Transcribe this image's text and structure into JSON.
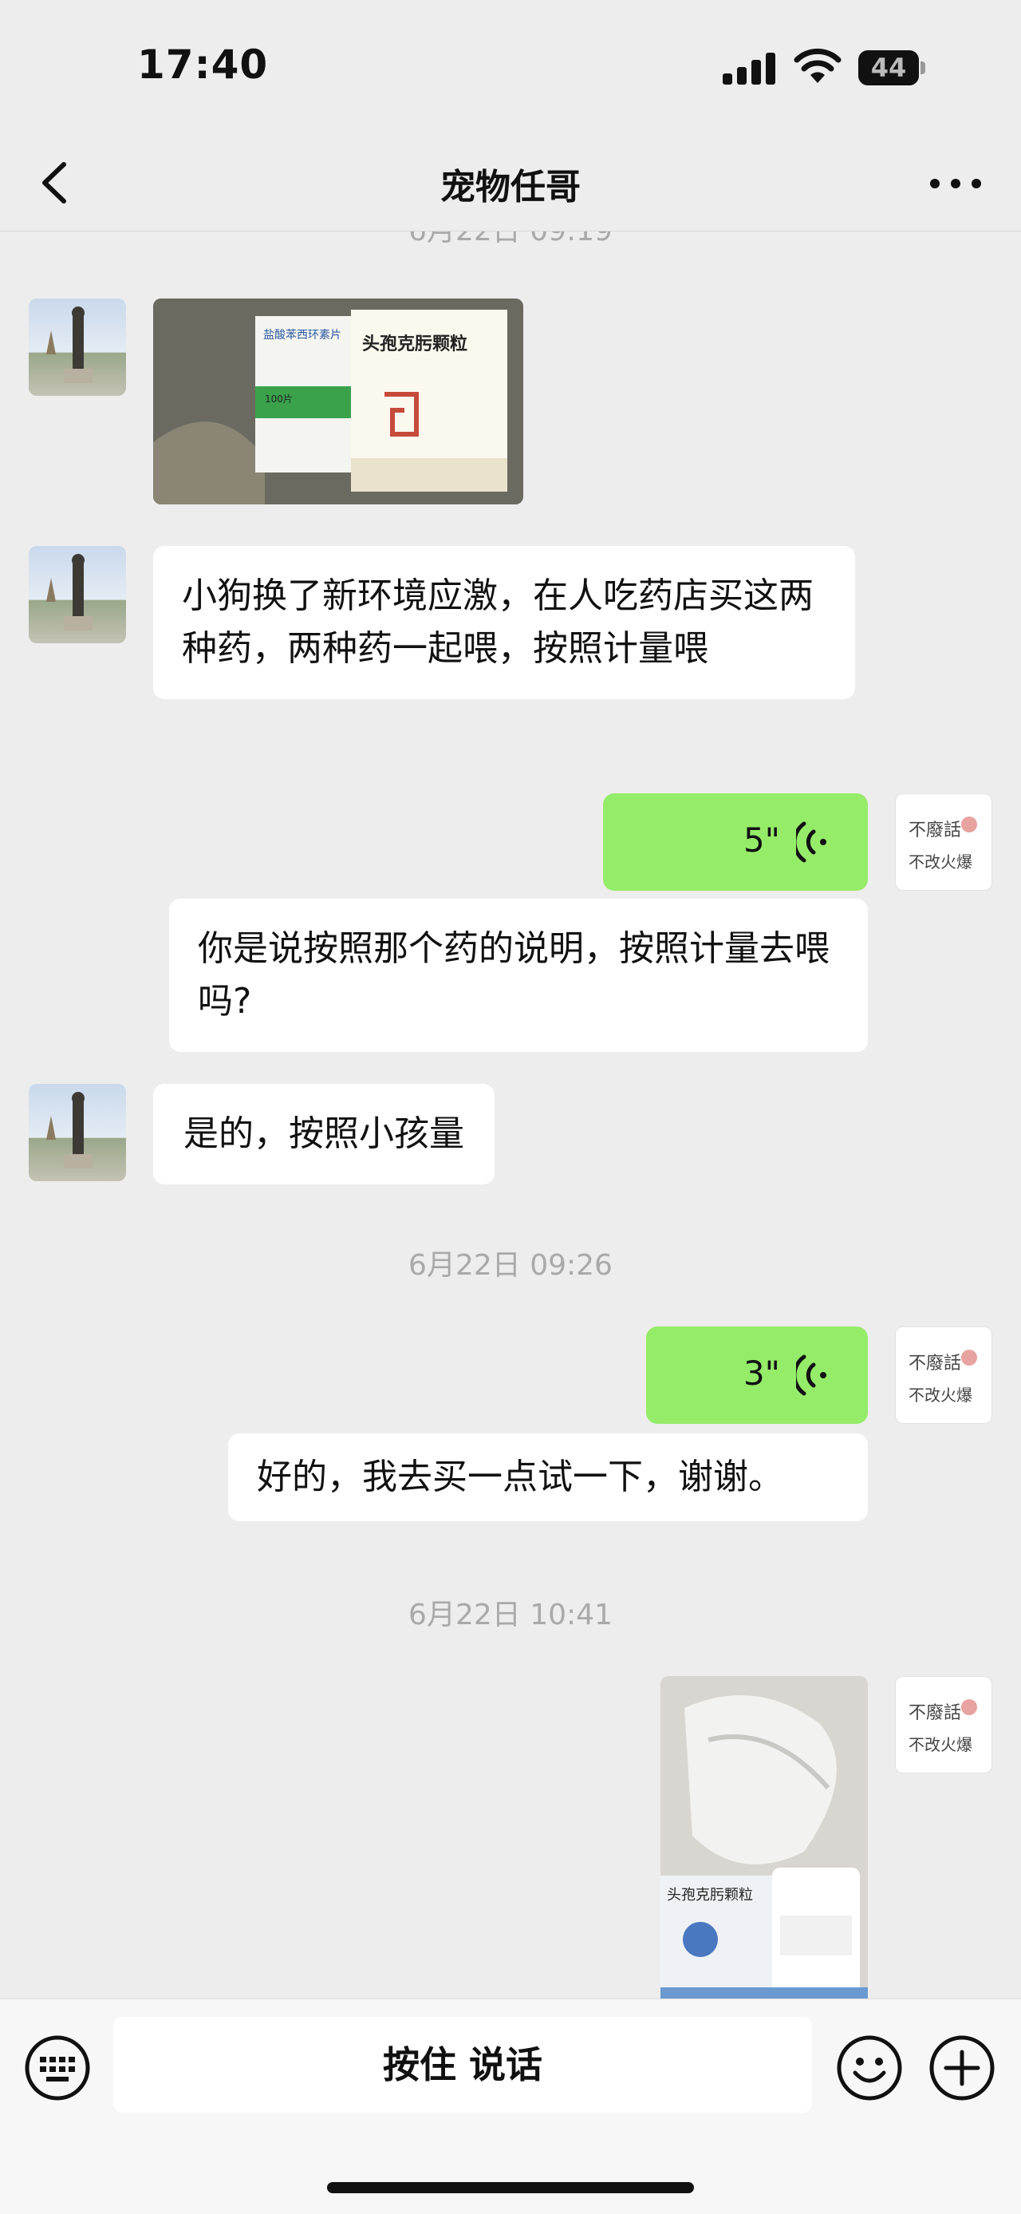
{
  "status_bar": {
    "time": "17:40",
    "battery": "44"
  },
  "header": {
    "title": "宠物任哥"
  },
  "messages": {
    "ts_top_partial": "6月22日 09:19",
    "msg_text_1": "小狗换了新环境应激，在人吃药店买这两种药，两种药一起喂，按照计量喂",
    "voice_1": "5\"",
    "msg_text_2": "你是说按照那个药的说明，按照计量去喂吗?",
    "msg_text_3": "是的，按照小孩量",
    "ts_2": "6月22日 09:26",
    "voice_2": "3\"",
    "msg_text_4": "好的，我去买一点试一下，谢谢。",
    "ts_3": "6月22日 10:41"
  },
  "photo_1": {
    "box_left_label": "盐酸苯西环素片",
    "box_right_label": "头孢克肟颗粒",
    "box_small_label": "100片"
  },
  "photo_2": {
    "box_label": "头孢克肟颗粒"
  },
  "my_avatar": {
    "line1": "不廢話",
    "line2": "不改火爆"
  },
  "input_bar": {
    "hold_to_talk": "按住 说话"
  },
  "colors": {
    "bg": "#ededed",
    "bubble_me": "#95ec69",
    "bubble_other": "#ffffff",
    "timestamp": "#a9a9a9"
  },
  "icons": [
    "back-icon",
    "more-icon",
    "signal-icon",
    "wifi-icon",
    "battery-icon",
    "voice-wave-icon",
    "keyboard-icon",
    "emoji-icon",
    "plus-icon"
  ]
}
